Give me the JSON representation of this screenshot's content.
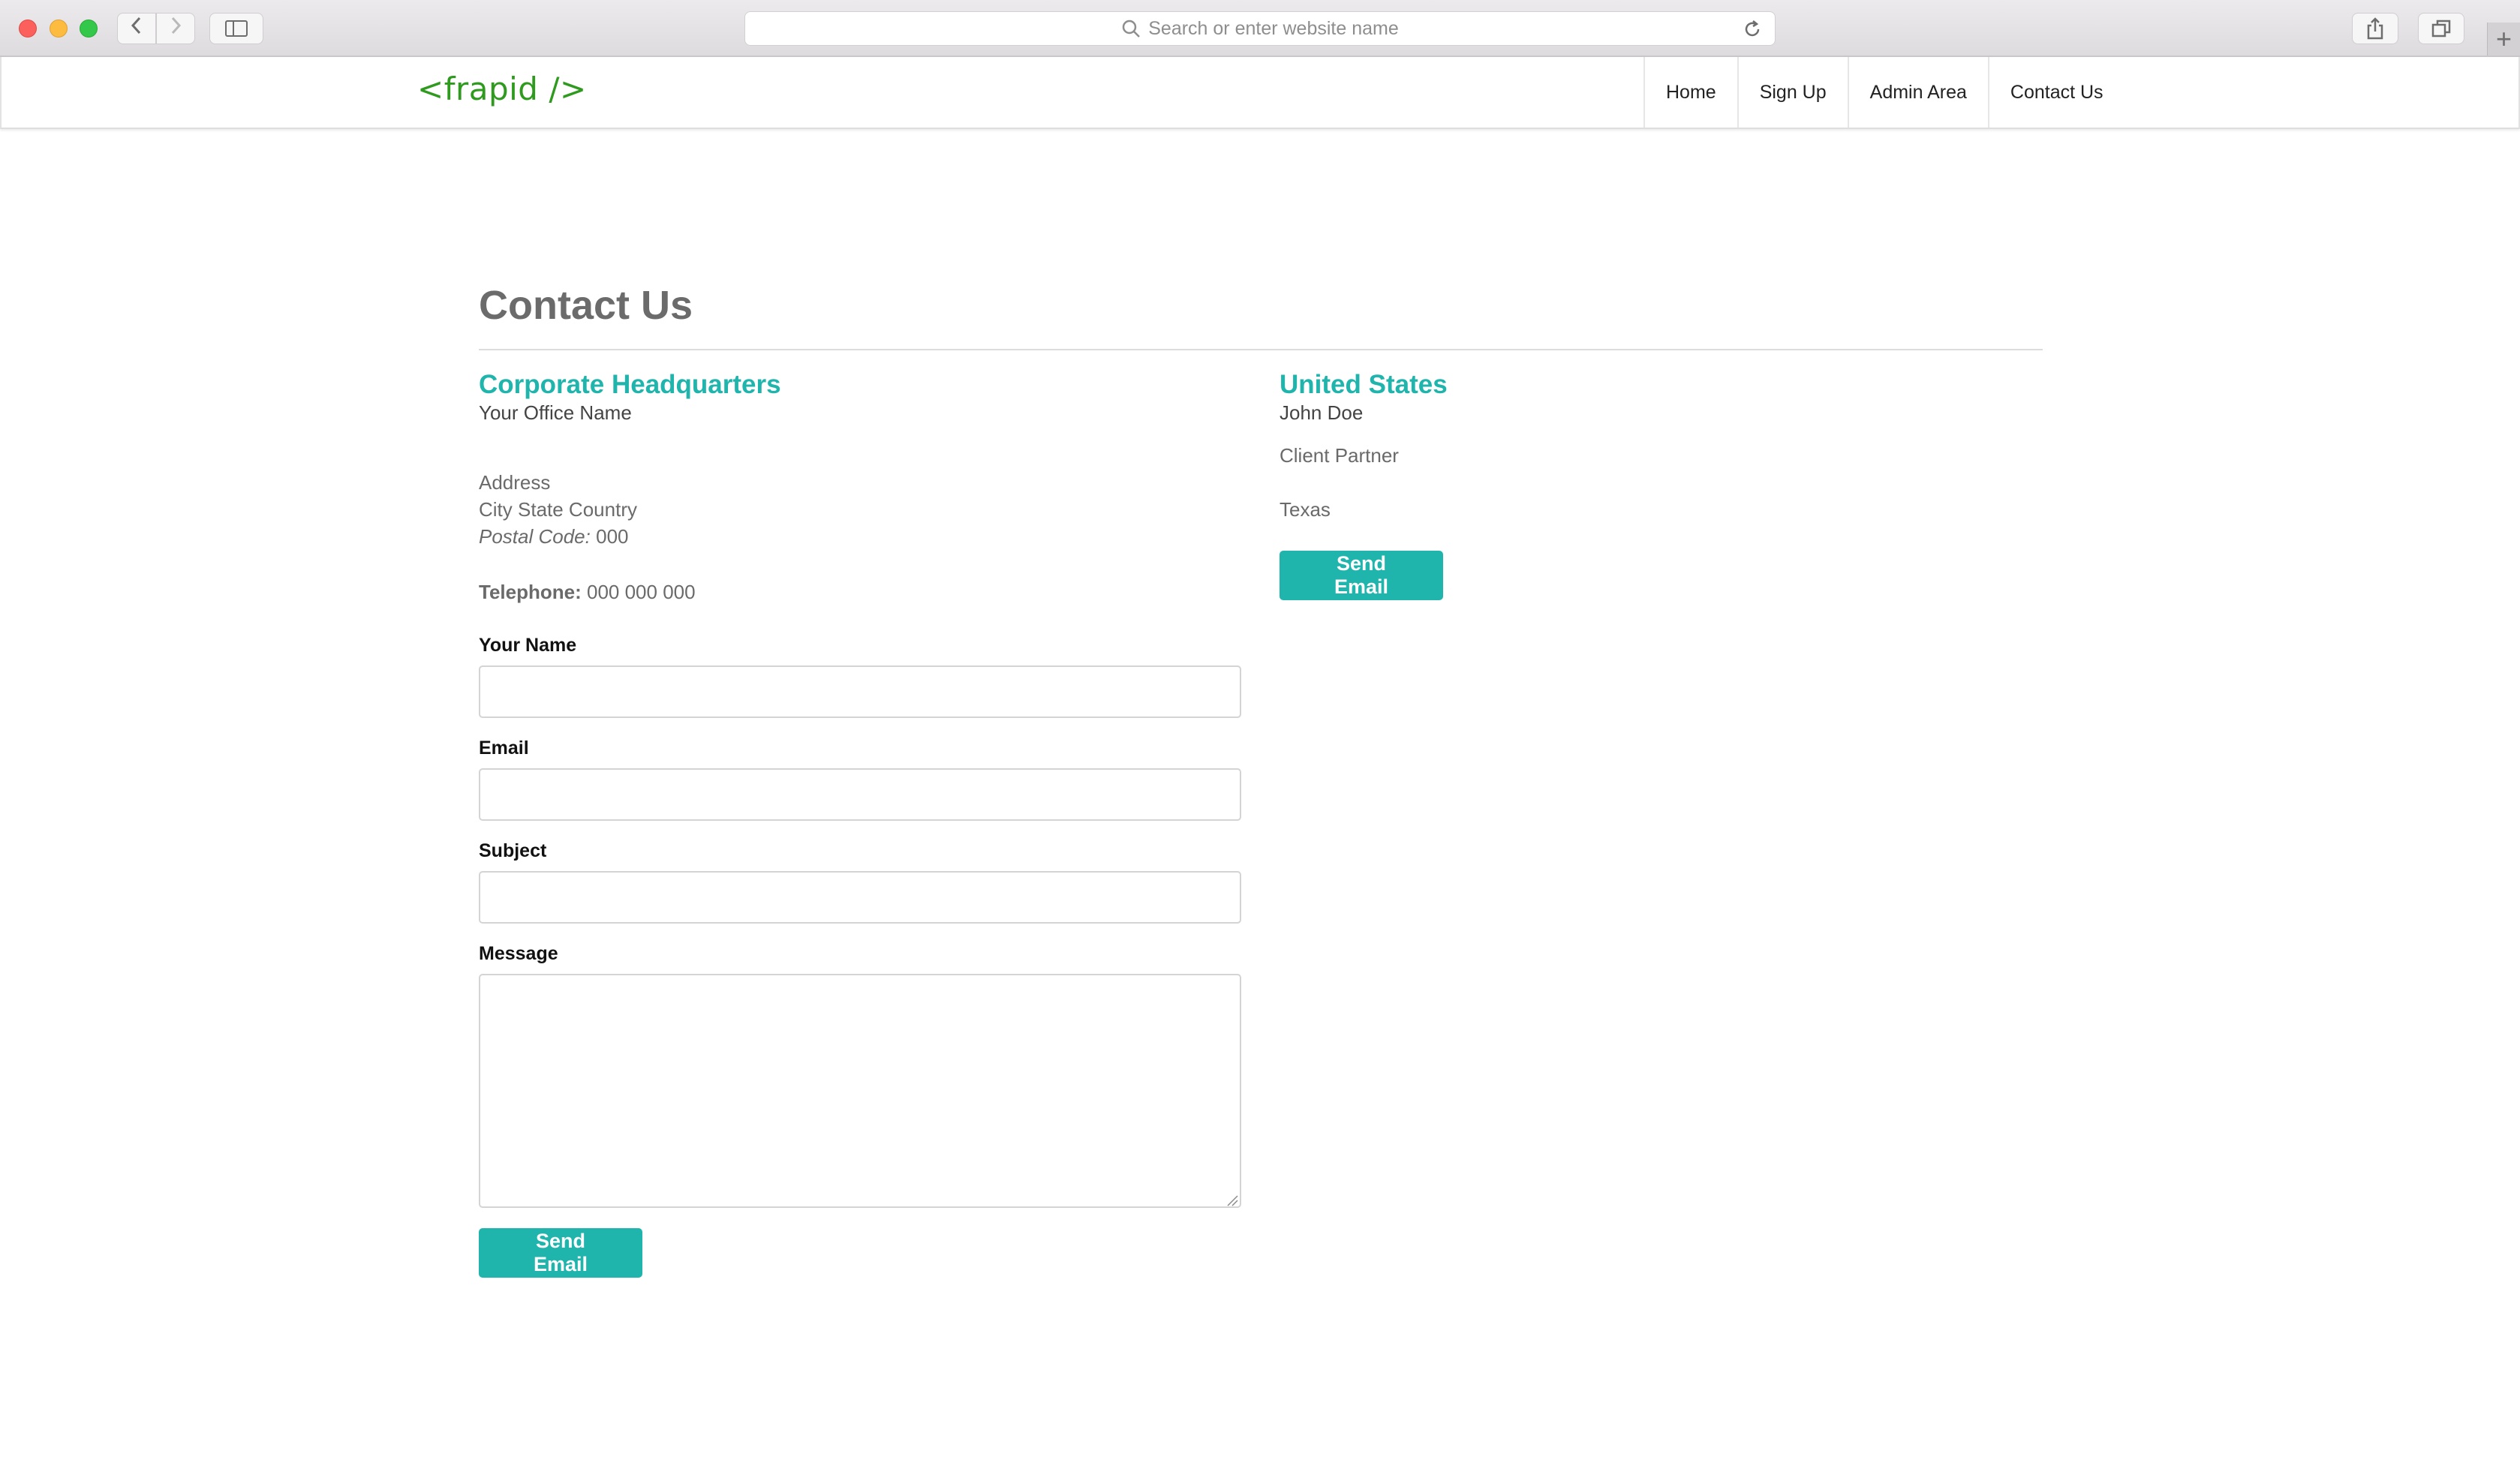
{
  "browser": {
    "address_placeholder": "Search or enter website name",
    "new_tab_symbol": "+"
  },
  "navbar": {
    "brand": "<frapid />",
    "items": [
      {
        "label": "Home"
      },
      {
        "label": "Sign Up"
      },
      {
        "label": "Admin Area"
      },
      {
        "label": "Contact Us"
      }
    ]
  },
  "page": {
    "title": "Contact Us"
  },
  "headquarters": {
    "heading": "Corporate Headquarters",
    "office_name": "Your Office Name",
    "address": "Address",
    "city_line": "City State Country",
    "postal_label": "Postal Code:",
    "postal_value": "000",
    "telephone_label": "Telephone:",
    "telephone_value": "000 000 000"
  },
  "form": {
    "name_label": "Your Name",
    "email_label": "Email",
    "subject_label": "Subject",
    "message_label": "Message",
    "name_value": "",
    "email_value": "",
    "subject_value": "",
    "message_value": "",
    "submit_label": "Send Email"
  },
  "contact_person": {
    "heading": "United States",
    "name": "John Doe",
    "role": "Client Partner",
    "location": "Texas",
    "button_label": "Send Email"
  },
  "colors": {
    "accent": "#1fb5ad",
    "brand": "#2e9a1e",
    "title": "#6b6b6b"
  }
}
